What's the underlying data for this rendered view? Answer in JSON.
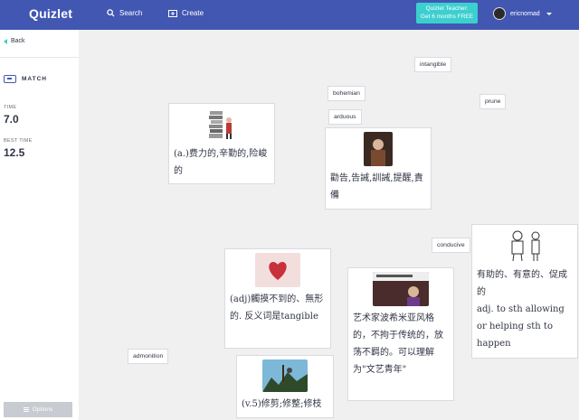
{
  "header": {
    "logo": "Quizlet",
    "search_label": "Search",
    "create_label": "Create",
    "promo_line1": "Quizlet Teacher:",
    "promo_line2": "Get 6 months FREE",
    "username": "ericnomad"
  },
  "sidebar": {
    "back_label": "Back",
    "mode_label": "MATCH",
    "time_label": "TIME",
    "time_value": "7.0",
    "best_label": "BEST TIME",
    "best_value": "12.5",
    "options_label": "Options"
  },
  "words": [
    {
      "label": "intangible"
    },
    {
      "label": "bohemian"
    },
    {
      "label": "arduous"
    },
    {
      "label": "prune"
    },
    {
      "label": "conducive"
    },
    {
      "label": "admonition"
    }
  ],
  "cards": [
    {
      "text": "(a.)费力的,辛勤的,险峻的",
      "image": "books-illustration"
    },
    {
      "text": "勸告,告誡,訓誡,提醒,責備",
      "image": "portrait-photo"
    },
    {
      "text": "(adj)觸摸不到的、無形的. 反义词是tangible",
      "image": "heart-photo"
    },
    {
      "text": "艺术家波希米亚风格的，不拘于传统的，放荡不羁的。可以理解为\"文艺青年\"",
      "image": "bohemian-slide"
    },
    {
      "text": "有助的、有意的、促成的",
      "text2": "adj. to sth allowing or helping sth to happen",
      "image": "cartoon-figures"
    },
    {
      "text": "(v.5)修剪;修整;修枝",
      "image": "pruning-photo"
    }
  ],
  "colors": {
    "brand_blue": "#4257b2",
    "accent_teal": "#3ccfcf"
  }
}
